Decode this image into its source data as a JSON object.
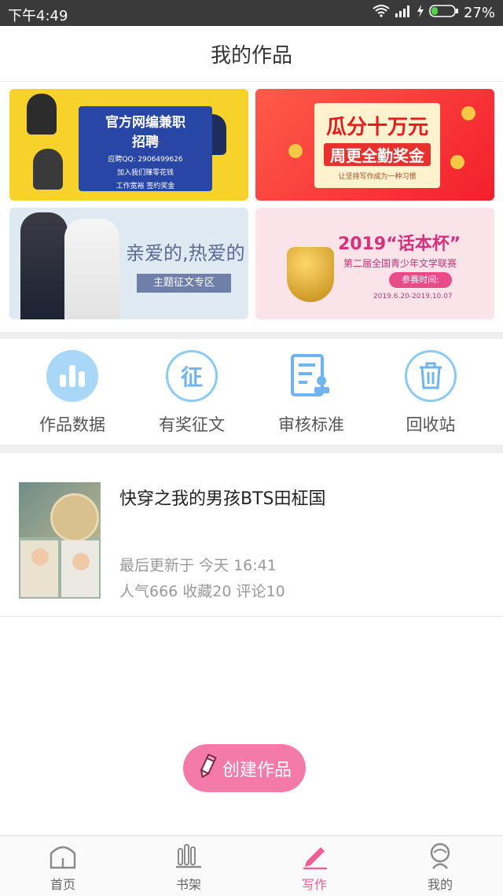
{
  "status_bar": {
    "time": "下午4:49",
    "battery": "27%"
  },
  "header": {
    "title": "我的作品"
  },
  "banners": [
    {
      "line1": "官方网编兼职",
      "line2": "招聘",
      "line3": "应聘QQ: 2906499626",
      "line4": "加入我们赚零花钱",
      "line5": "工作宽裕  签约奖金"
    },
    {
      "line1": "瓜分十万元",
      "line2": "周更全勤奖金",
      "line3": "让坚持写作成为一种习惯"
    },
    {
      "line1": "亲爱的,热爱的",
      "line2": "主题征文专区"
    },
    {
      "line1": "2019“话本杯”",
      "line2": "第二届全国青少年文学联赛",
      "line3": "参赛时间:",
      "line4": "2019.6.20-2019.10.07"
    }
  ],
  "shortcuts": [
    {
      "label": "作品数据",
      "icon": "bar-chart-icon"
    },
    {
      "label": "有奖征文",
      "icon": "contest-icon"
    },
    {
      "label": "审核标准",
      "icon": "document-review-icon"
    },
    {
      "label": "回收站",
      "icon": "trash-icon"
    }
  ],
  "works": [
    {
      "title": "快穿之我的男孩BTS田柾国",
      "updated": "最后更新于 今天 16:41",
      "stats": "人气666 收藏20 评论10"
    }
  ],
  "create_button": {
    "label": "创建作品"
  },
  "tabbar": {
    "items": [
      {
        "label": "首页",
        "icon": "home-icon"
      },
      {
        "label": "书架",
        "icon": "bookshelf-icon"
      },
      {
        "label": "写作",
        "icon": "pen-icon"
      },
      {
        "label": "我的",
        "icon": "profile-icon"
      }
    ],
    "active": "写作"
  },
  "colors": {
    "accent": "#ee5d93",
    "create_button": "#f47aa9",
    "icon_blue": "#6fb4ee",
    "status_bar": "#3a3a3a"
  }
}
